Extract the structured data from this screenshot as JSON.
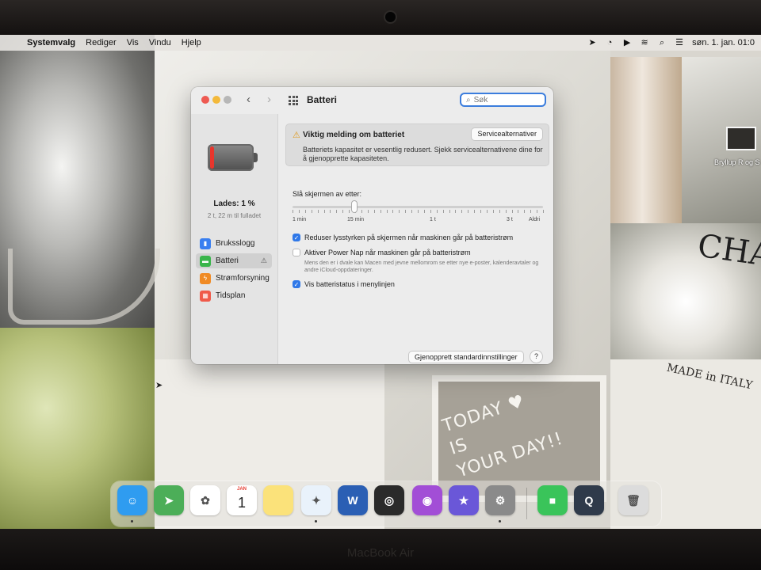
{
  "menubar": {
    "apple": "",
    "app_name": "Systemvalg",
    "menus": [
      "Rediger",
      "Vis",
      "Vindu",
      "Hjelp"
    ],
    "clock": "søn. 1. jan. 01:0",
    "status_icons": [
      "location-icon",
      "screen-time-icon",
      "play-icon",
      "wifi-icon",
      "search-icon",
      "control-center-icon"
    ]
  },
  "desktop": {
    "item_label": "Bryllup R og S re",
    "board_text": "TODAY ♥\nIS\nYOUR DAY!!",
    "magazine_text": "MADE in ITALY",
    "wall_text": "CHA"
  },
  "window": {
    "title": "Batteri",
    "search_placeholder": "Søk",
    "sidebar": {
      "charge_title": "Lades: 1 %",
      "charge_sub": "2 t, 22 m til fulladet",
      "items": [
        {
          "label": "Bruksslogg",
          "icon": "usage-chart-icon",
          "color": "#3a7ff0"
        },
        {
          "label": "Batteri",
          "icon": "battery-icon",
          "color": "#39b54a",
          "warning": "⚠"
        },
        {
          "label": "Strømforsyning",
          "icon": "lightning-icon",
          "color": "#f08a24"
        },
        {
          "label": "Tidsplan",
          "icon": "calendar-icon",
          "color": "#f05a4a"
        }
      ]
    },
    "alert": {
      "title": "Viktig melding om batteriet",
      "button": "Servicealternativer",
      "body": "Batteriets kapasitet er vesentlig redusert. Sjekk servicealternativene dine for å gjenopprette kapasiteten."
    },
    "slider": {
      "label": "Slå skjermen av etter:",
      "tick_labels": [
        "1 min",
        "15 min",
        "1 t",
        "3 t",
        "Aldri"
      ],
      "value": "15 min"
    },
    "options": [
      {
        "label": "Reduser lysstyrken på skjermen når maskinen går på batteristrøm",
        "checked": true
      },
      {
        "label": "Aktiver Power Nap når maskinen går på batteristrøm",
        "checked": false,
        "note": "Mens den er i dvale kan Macen med jevne mellomrom se etter nye e-poster, kalenderavtaler og andre iCloud-oppdateringer."
      },
      {
        "label": "Vis batteristatus i menylinjen",
        "checked": true
      }
    ],
    "restore_button": "Gjenopprett standardinnstillinger",
    "help_button": "?"
  },
  "dock": {
    "apps": [
      {
        "name": "finder-icon",
        "color": "#2f9cf0",
        "glyph": "☺",
        "running": true
      },
      {
        "name": "maps-icon",
        "color": "#4cae58",
        "glyph": "➤",
        "running": false
      },
      {
        "name": "photos-icon",
        "color": "#ffffff",
        "glyph": "✿",
        "running": false
      },
      {
        "name": "calendar-icon",
        "color": "#ffffff",
        "glyph": "",
        "running": false
      },
      {
        "name": "notes-icon",
        "color": "#fbe27a",
        "glyph": "",
        "running": false
      },
      {
        "name": "safari-icon",
        "color": "#e9f2fb",
        "glyph": "✦",
        "running": true
      },
      {
        "name": "word-icon",
        "color": "#2b5fb4",
        "glyph": "W",
        "running": false
      },
      {
        "name": "blender-icon",
        "color": "#2a2a2a",
        "glyph": "◎",
        "running": false
      },
      {
        "name": "podcasts-icon",
        "color": "#a24ed6",
        "glyph": "◉",
        "running": false
      },
      {
        "name": "imovie-icon",
        "color": "#6a57d8",
        "glyph": "★",
        "running": false
      },
      {
        "name": "system-preferences-icon",
        "color": "#8a8a8a",
        "glyph": "⚙",
        "running": true
      },
      {
        "name": "facetime-icon",
        "color": "#3ac45a",
        "glyph": "■",
        "running": false
      },
      {
        "name": "quicktime-icon",
        "color": "#2f3a4a",
        "glyph": "Q",
        "running": false
      },
      {
        "name": "trash-icon",
        "color": "#dcdcdc",
        "glyph": "🗑",
        "running": false
      }
    ],
    "calendar_month": "JAN",
    "calendar_day": "1"
  },
  "hardware": {
    "brand": "MacBook Air"
  }
}
